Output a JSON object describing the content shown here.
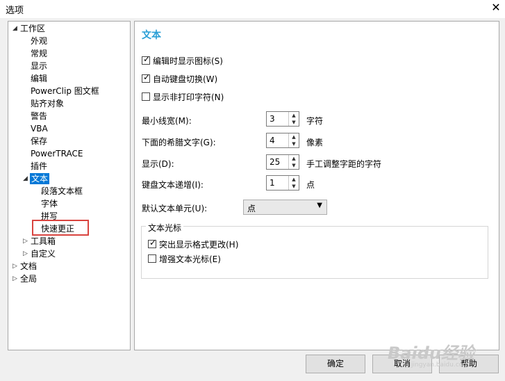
{
  "window": {
    "title": "选项",
    "close_glyph": "✕"
  },
  "tree": {
    "items": [
      {
        "label": "工作区",
        "expander": "◢"
      },
      {
        "label": "外观"
      },
      {
        "label": "常规"
      },
      {
        "label": "显示"
      },
      {
        "label": "编辑"
      },
      {
        "label": "PowerClip 图文框"
      },
      {
        "label": "贴齐对象"
      },
      {
        "label": "警告"
      },
      {
        "label": "VBA"
      },
      {
        "label": "保存"
      },
      {
        "label": "PowerTRACE"
      },
      {
        "label": "插件"
      },
      {
        "label": "文本",
        "expander": "◢"
      },
      {
        "label": "段落文本框"
      },
      {
        "label": "字体"
      },
      {
        "label": "拼写"
      },
      {
        "label": "快速更正"
      },
      {
        "label": "工具箱",
        "expander": "▷"
      },
      {
        "label": "自定义",
        "expander": "▷"
      },
      {
        "label": "文档",
        "expander": "▷"
      },
      {
        "label": "全局",
        "expander": "▷"
      }
    ]
  },
  "panel": {
    "title": "文本",
    "checkboxes": [
      {
        "label": "编辑时显示图标(S)",
        "checked": true,
        "mark": "✓"
      },
      {
        "label": "自动键盘切换(W)",
        "checked": true,
        "mark": "✓"
      },
      {
        "label": "显示非打印字符(N)",
        "checked": false,
        "mark": ""
      }
    ],
    "fields": [
      {
        "label": "最小线宽(M):",
        "value": "3",
        "unit": "字符"
      },
      {
        "label": "下面的希腊文字(G):",
        "value": "4",
        "unit": "像素"
      },
      {
        "label": "显示(D):",
        "value": "25",
        "unit": "手工调整字距的字符"
      },
      {
        "label": "键盘文本递增(I):",
        "value": "1",
        "unit": "点"
      }
    ],
    "spin_up": "▲",
    "spin_down": "▼",
    "default_unit": {
      "label": "默认文本单元(U):",
      "value": "点",
      "arrow": "▼"
    },
    "cursor_group": {
      "title": "文本光标",
      "checkboxes": [
        {
          "label": "突出显示格式更改(H)",
          "checked": true,
          "mark": "✓"
        },
        {
          "label": "增强文本光标(E)",
          "checked": false,
          "mark": ""
        }
      ]
    }
  },
  "buttons": {
    "ok": "确定",
    "cancel": "取消",
    "help": "帮助"
  },
  "watermark": {
    "text": "Baidu经验",
    "sub": "jingyan.baidu.com"
  },
  "colors": {
    "selected": "#0078d7",
    "section_title": "#2a9fd6",
    "highlight": "#d9443f"
  }
}
